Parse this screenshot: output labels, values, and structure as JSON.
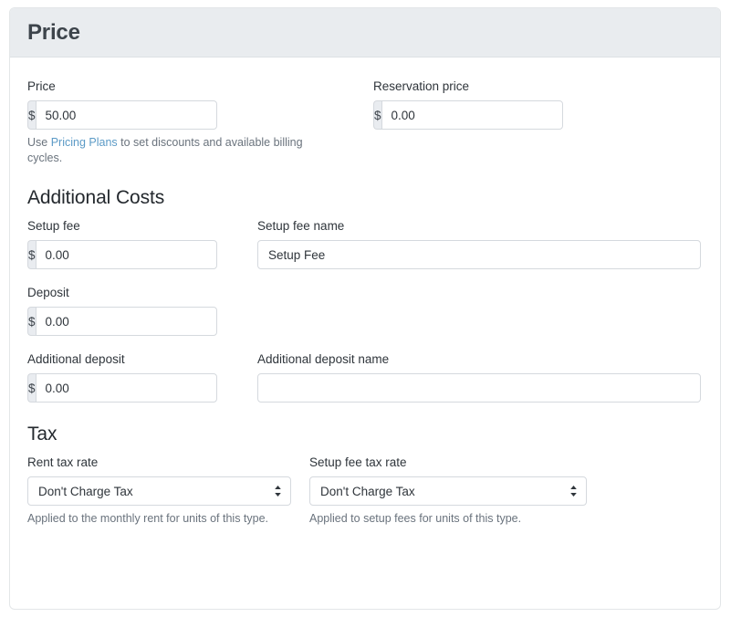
{
  "card": {
    "title": "Price"
  },
  "price_section": {
    "price": {
      "label": "Price",
      "currency_symbol": "$",
      "value": "50.00"
    },
    "reservation_price": {
      "label": "Reservation price",
      "currency_symbol": "$",
      "value": "0.00"
    },
    "help": {
      "before": "Use ",
      "link": "Pricing Plans",
      "after": " to set discounts and available billing cycles."
    }
  },
  "additional_costs": {
    "heading": "Additional Costs",
    "setup_fee": {
      "label": "Setup fee",
      "currency_symbol": "$",
      "value": "0.00"
    },
    "setup_fee_name": {
      "label": "Setup fee name",
      "value": "Setup Fee"
    },
    "deposit": {
      "label": "Deposit",
      "currency_symbol": "$",
      "value": "0.00"
    },
    "additional_deposit": {
      "label": "Additional deposit",
      "currency_symbol": "$",
      "value": "0.00"
    },
    "additional_deposit_name": {
      "label": "Additional deposit name",
      "value": ""
    }
  },
  "tax": {
    "heading": "Tax",
    "rent_tax_rate": {
      "label": "Rent tax rate",
      "selected": "Don't Charge Tax",
      "help": "Applied to the monthly rent for units of this type."
    },
    "setup_fee_tax_rate": {
      "label": "Setup fee tax rate",
      "selected": "Don't Charge Tax",
      "help": "Applied to setup fees for units of this type."
    }
  },
  "colors": {
    "header_bg": "#e9ecef",
    "border": "#d5d9de",
    "link": "#5b9ac6",
    "text": "#2f353b",
    "muted": "#6a737d"
  }
}
